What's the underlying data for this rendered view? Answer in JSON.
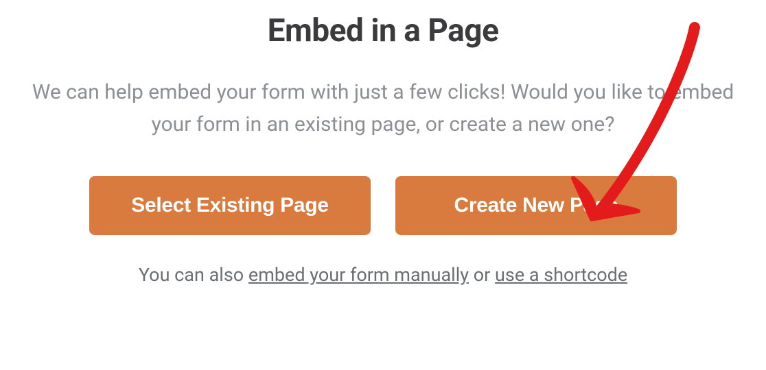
{
  "modal": {
    "title": "Embed in a Page",
    "subtitle": "We can help embed your form with just a few clicks! Would you like to embed your form in an existing page, or create a new one?",
    "buttons": {
      "select_existing": "Select Existing Page",
      "create_new": "Create New Page"
    },
    "footer": {
      "prefix": "You can also ",
      "link1": "embed your form manually",
      "separator": " or ",
      "link2": "use a shortcode"
    }
  },
  "annotation": {
    "color": "#e41b1b"
  }
}
